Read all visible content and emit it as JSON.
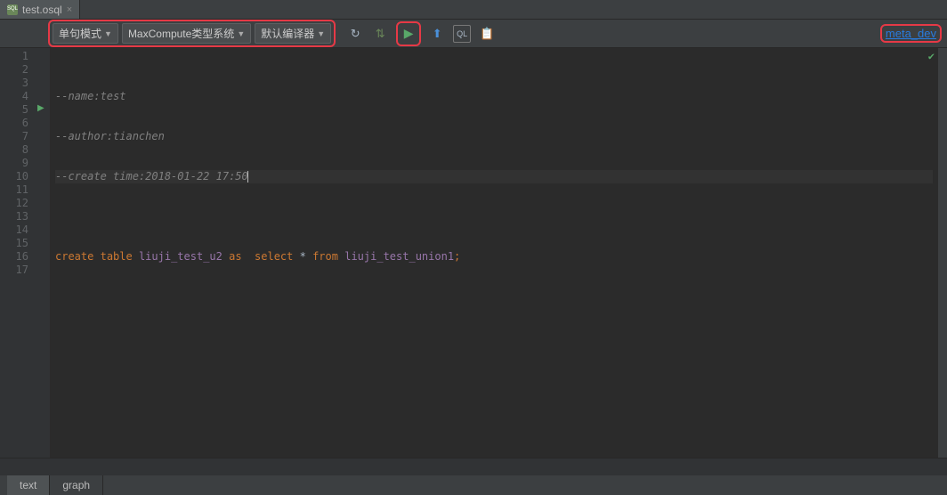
{
  "tab": {
    "filename": "test.osql"
  },
  "toolbar": {
    "dropdowns": {
      "mode": "单句模式",
      "type_system": "MaxCompute类型系统",
      "compiler": "默认编译器"
    },
    "meta_link": "meta_dev"
  },
  "gutter": {
    "lines": [
      "1",
      "2",
      "3",
      "4",
      "5",
      "6",
      "7",
      "8",
      "9",
      "10",
      "11",
      "12",
      "13",
      "14",
      "15",
      "16",
      "17"
    ]
  },
  "code": {
    "l1_cmt": "--name:test",
    "l2_cmt": "--author:tianchen",
    "l3_cmt": "--create time:2018-01-22 17:50",
    "l5_kw1": "create",
    "l5_kw2": "table",
    "l5_id1": "liuji_test_u2",
    "l5_kw3": "as",
    "l5_kw4": "select",
    "l5_star": "*",
    "l5_kw5": "from",
    "l5_id2": "liuji_test_union1",
    "l5_semi": ";"
  },
  "bottom_tabs": {
    "text": "text",
    "graph": "graph"
  }
}
